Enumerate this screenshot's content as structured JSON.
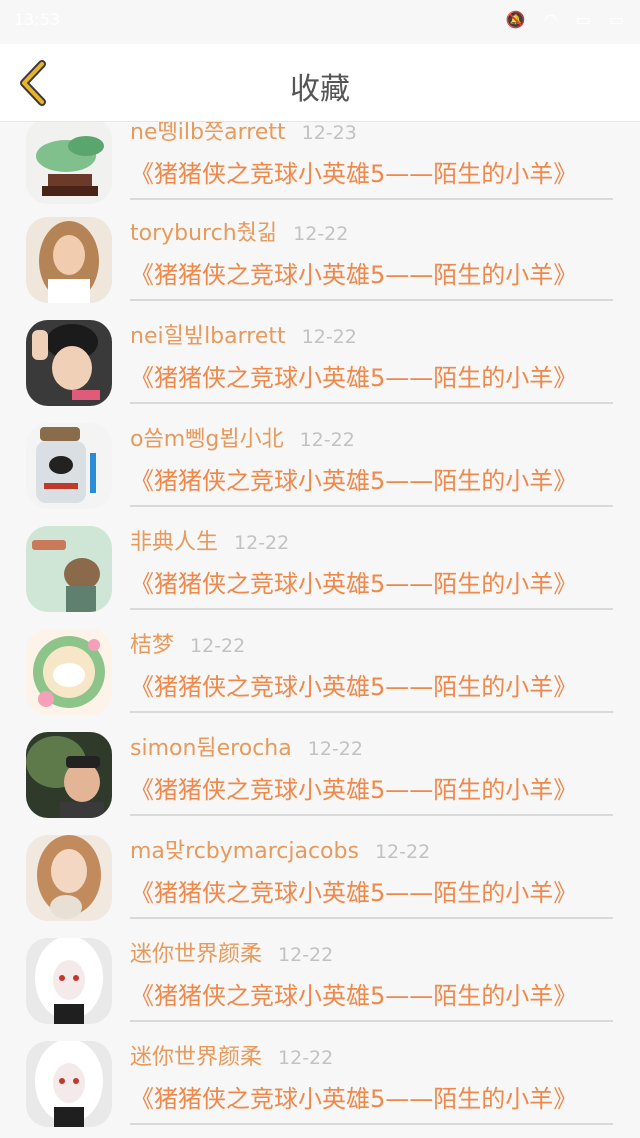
{
  "status_bar": {
    "time": "13:53",
    "icons": [
      "mute-icon",
      "wifi-icon",
      "sim-icon",
      "battery-icon"
    ]
  },
  "header": {
    "title": "收藏",
    "back_icon": "chevron-left-icon",
    "accent": "#e8b42c"
  },
  "colors": {
    "name": "#e89a5c",
    "book": "#f0884a",
    "date": "#c2c2c2"
  },
  "items": [
    {
      "name": "ne뗑ilb쯧arrett",
      "date": "12-23",
      "book": "《猪猪侠之竞球小英雄5——陌生的小羊》"
    },
    {
      "name": "toryburch췄긺",
      "date": "12-22",
      "book": "《猪猪侠之竞球小英雄5——陌生的小羊》"
    },
    {
      "name": "nei힐빞lbarrett",
      "date": "12-22",
      "book": "《猪猪侠之竞球小英雄5——陌生的小羊》"
    },
    {
      "name": "o씀m뼁g뵙小北",
      "date": "12-22",
      "book": "《猪猪侠之竞球小英雄5——陌生的小羊》"
    },
    {
      "name": "非典人生",
      "date": "12-22",
      "book": "《猪猪侠之竞球小英雄5——陌生的小羊》"
    },
    {
      "name": "桔梦",
      "date": "12-22",
      "book": "《猪猪侠之竞球小英雄5——陌生的小羊》"
    },
    {
      "name": "simon뒴erocha",
      "date": "12-22",
      "book": "《猪猪侠之竞球小英雄5——陌生的小羊》"
    },
    {
      "name": "ma맞rcbymarcjacobs",
      "date": "12-22",
      "book": "《猪猪侠之竞球小英雄5——陌生的小羊》"
    },
    {
      "name": "迷你世界颜柔",
      "date": "12-22",
      "book": "《猪猪侠之竞球小英雄5——陌生的小羊》"
    },
    {
      "name": "迷你世界颜柔",
      "date": "12-22",
      "book": "《猪猪侠之竞球小英雄5——陌生的小羊》"
    }
  ]
}
